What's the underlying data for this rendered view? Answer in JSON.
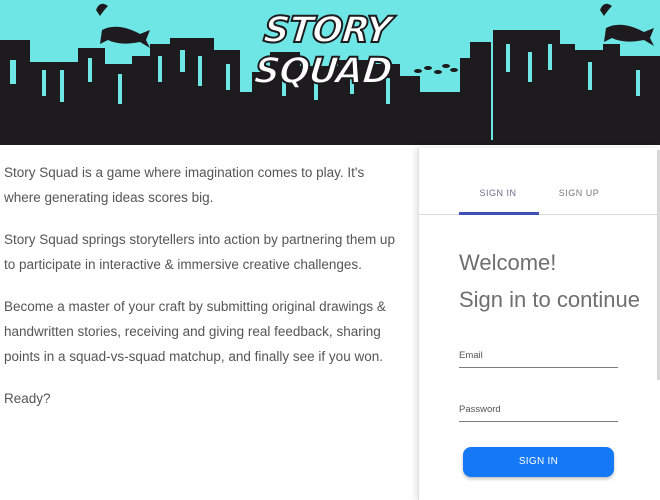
{
  "banner": {
    "logo_text": "STORY SQUAD",
    "colors": {
      "sky": "#6fe6e6",
      "skyline": "#1d1b1d"
    }
  },
  "intro": {
    "paragraphs": [
      "Story Squad is a game where imagination comes to play. It's where generating ideas scores big.",
      "Story Squad springs storytellers into action by partnering them up to participate in interactive & immersive creative challenges.",
      "Become a master of your craft by submitting original drawings & handwritten stories, receiving and giving real feedback, sharing points in a squad-vs-squad matchup, and finally see if you won.",
      "Ready?"
    ]
  },
  "auth": {
    "tabs": {
      "signin": "SIGN IN",
      "signup": "SIGN UP"
    },
    "welcome_line1": "Welcome!",
    "welcome_line2": "Sign in to continue",
    "email_label": "Email",
    "password_label": "Password",
    "submit_label": "SIGN IN",
    "colors": {
      "tab_underline": "#3f51b5",
      "button": "#1578f7"
    }
  }
}
